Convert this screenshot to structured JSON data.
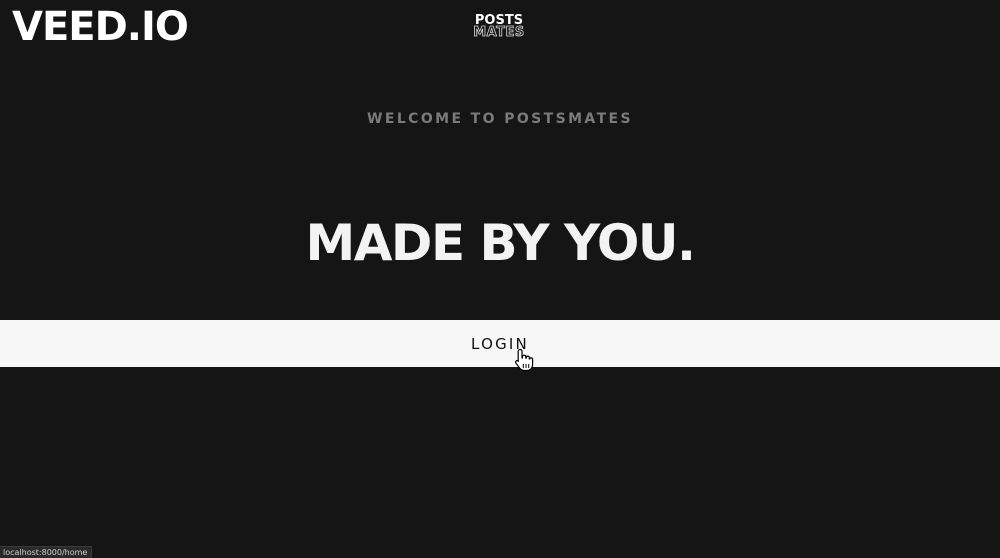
{
  "watermark": {
    "text": "VEED.IO"
  },
  "logo": {
    "line1": "POSTS",
    "line2": "MATES"
  },
  "hero": {
    "welcome": "WELCOME TO POSTSMATES",
    "headline": "MADE BY YOU."
  },
  "login": {
    "label": "LOGIN"
  },
  "status_bar": {
    "url": "localhost:8000/home"
  },
  "colors": {
    "background": "#151515",
    "button": "#f7f7f7",
    "welcome_text": "#7b7b7b"
  },
  "icons": {
    "cursor": "hand-pointer-icon"
  }
}
